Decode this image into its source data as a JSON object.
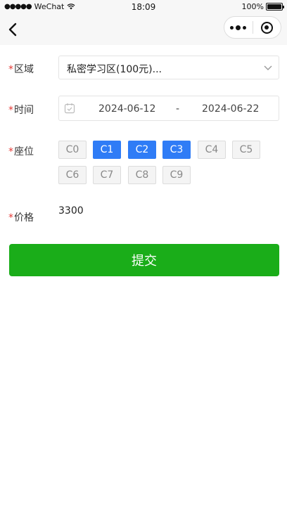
{
  "status_bar": {
    "signal_dots": "●●●●●",
    "carrier": "WeChat",
    "time": "18:09",
    "battery": "100%"
  },
  "nav": {
    "back_icon": "chevron-left-icon",
    "more_icon": "more-icon",
    "close_icon": "target-icon"
  },
  "form": {
    "required_mark": "*",
    "area": {
      "label": "区域",
      "value": "私密学习区(100元)..."
    },
    "time": {
      "label": "时间",
      "start": "2024-06-12",
      "separator": "-",
      "end": "2024-06-22"
    },
    "seat": {
      "label": "座位",
      "options": [
        {
          "label": "C0",
          "selected": false
        },
        {
          "label": "C1",
          "selected": true
        },
        {
          "label": "C2",
          "selected": true
        },
        {
          "label": "C3",
          "selected": true
        },
        {
          "label": "C4",
          "selected": false
        },
        {
          "label": "C5",
          "selected": false
        },
        {
          "label": "C6",
          "selected": false
        },
        {
          "label": "C7",
          "selected": false
        },
        {
          "label": "C8",
          "selected": false
        },
        {
          "label": "C9",
          "selected": false
        }
      ]
    },
    "price": {
      "label": "价格",
      "value": "3300"
    },
    "submit_label": "提交"
  },
  "colors": {
    "accent_blue": "#2f7cf6",
    "submit_green": "#1aad19",
    "required_red": "#e53935"
  }
}
